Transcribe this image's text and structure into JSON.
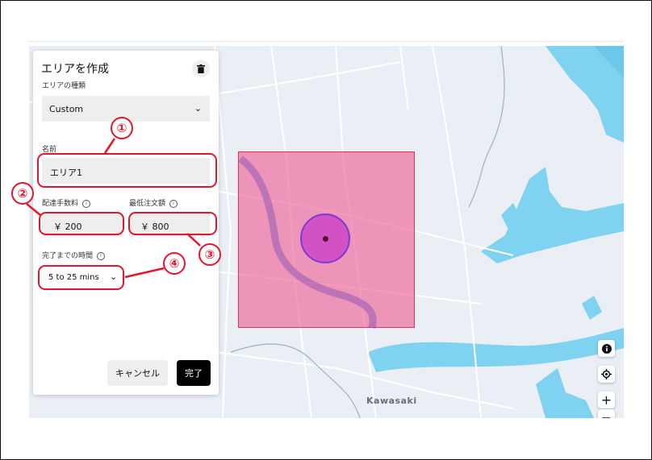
{
  "panel": {
    "title": "エリアを作成",
    "area_type_label": "エリアの種類",
    "area_type_value": "Custom",
    "name_label": "名前",
    "name_value": "エリア1",
    "delivery_fee_label": "配達手数料",
    "delivery_fee_value": "￥ 200",
    "min_order_label": "最低注文額",
    "min_order_value": "￥ 800",
    "time_label": "完了までの時間",
    "time_value": "5 to 25 mins",
    "cancel_label": "キャンセル",
    "done_label": "完了"
  },
  "map": {
    "place_label": "Kawasaki",
    "zoom_in": "+",
    "zoom_out": "−"
  },
  "callouts": [
    "①",
    "②",
    "③",
    "④"
  ],
  "icons": {
    "trash": "trash-icon",
    "chevron": "chevron-down-icon",
    "info": "info-icon",
    "locate": "locate-icon"
  },
  "colors": {
    "annotation": "#e2162c",
    "area_fill": "#f0649a",
    "circle_stroke": "#7b3bd9",
    "water": "#7fd3f0"
  }
}
